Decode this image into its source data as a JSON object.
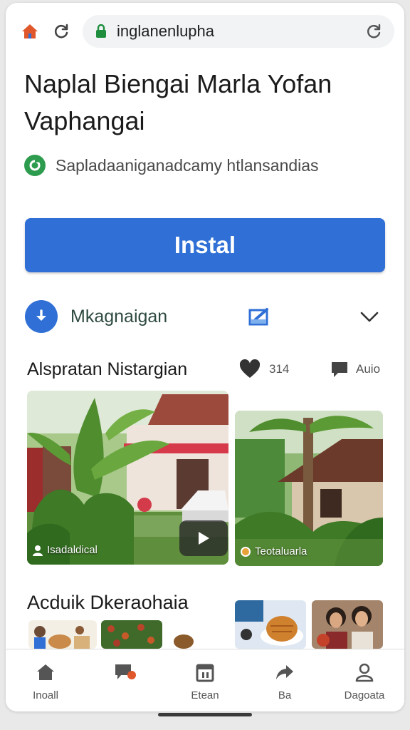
{
  "browser": {
    "url": "inglanenlupha",
    "icons": {
      "home": "home-icon",
      "reload": "reload-icon",
      "lock": "lock-icon"
    },
    "colors": {
      "home": "#e0572b",
      "lock": "#1e8e3e"
    }
  },
  "page": {
    "title": "Naplal Biengai Marla Yofan Vaphangai",
    "site_text": "Sapladaaniganadcamy htlansandias",
    "install_label": "Instal",
    "download_label": "Mkagnaigan",
    "section1": {
      "title": "Alspratan Nistargian",
      "like_count": "314",
      "comment_label": "Auio"
    },
    "photos": [
      {
        "caption": "Isadaldical"
      },
      {
        "caption": "Teotaluarla"
      }
    ],
    "section2": {
      "title": "Acduik Dkeraohaia"
    }
  },
  "bottom_nav": [
    {
      "icon": "home-icon",
      "label": "Inoall"
    },
    {
      "icon": "chat-icon",
      "label": ""
    },
    {
      "icon": "calendar-icon",
      "label": "Etean"
    },
    {
      "icon": "share-icon",
      "label": "Ba"
    },
    {
      "icon": "profile-icon",
      "label": "Dagoata"
    }
  ],
  "colors": {
    "accent": "#2f6fd6",
    "site_icon": "#2e9c4e"
  }
}
